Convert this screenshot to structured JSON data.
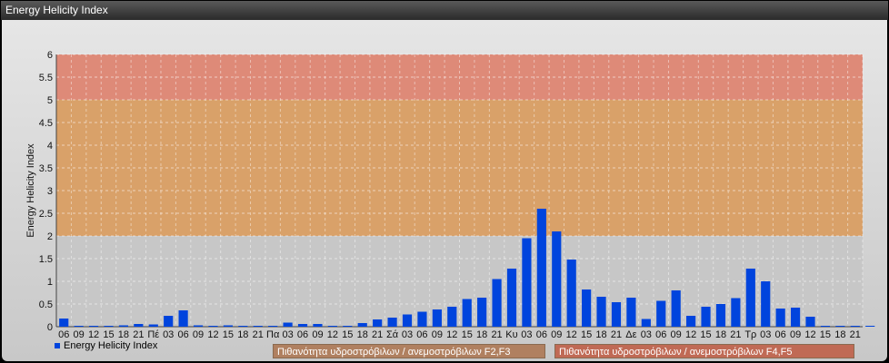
{
  "window": {
    "title": "Energy Helicity Index"
  },
  "chart_data": {
    "type": "bar",
    "title": "",
    "ylabel": "Energy Helicity Index",
    "ylim": [
      0,
      6
    ],
    "yticks": [
      "0",
      "0.5",
      "1",
      "1.5",
      "2",
      "2.5",
      "3",
      "3.5",
      "4",
      "4.5",
      "5",
      "5.5",
      "6"
    ],
    "bands": [
      {
        "from": 2,
        "to": 5,
        "color": "#d9a169"
      },
      {
        "from": 5,
        "to": 6,
        "color": "#de8a78"
      }
    ],
    "categories": [
      "06",
      "09",
      "12",
      "15",
      "18",
      "21",
      "Πέ",
      "03",
      "06",
      "09",
      "12",
      "15",
      "18",
      "21",
      "Πα",
      "03",
      "06",
      "09",
      "12",
      "15",
      "18",
      "21",
      "Σά",
      "03",
      "06",
      "09",
      "12",
      "15",
      "18",
      "21",
      "Κυ",
      "03",
      "06",
      "09",
      "12",
      "15",
      "18",
      "21",
      "Δε",
      "03",
      "06",
      "09",
      "12",
      "15",
      "18",
      "21",
      "Τρ",
      "03",
      "06",
      "09",
      "12",
      "15",
      "18",
      "21"
    ],
    "series": [
      {
        "name": "Energy Helicity Index",
        "color": "#0044dd",
        "values": [
          0.18,
          0.02,
          0.02,
          0.02,
          0.03,
          0.06,
          0.05,
          0.24,
          0.36,
          0.03,
          0.02,
          0.03,
          0.02,
          0.02,
          0.02,
          0.09,
          0.06,
          0.06,
          0.02,
          0.02,
          0.08,
          0.16,
          0.2,
          0.27,
          0.33,
          0.38,
          0.44,
          0.61,
          0.64,
          1.05,
          1.28,
          1.95,
          2.6,
          2.1,
          1.48,
          0.82,
          0.66,
          0.54,
          0.64,
          0.17,
          0.57,
          0.8,
          0.24,
          0.44,
          0.5,
          0.63,
          1.28,
          1.0,
          0.4,
          0.42,
          0.22,
          0.02,
          0.02,
          0.02,
          0.02
        ]
      }
    ],
    "grid": true,
    "legend": "bottom-left"
  },
  "legend": {
    "series_label": "Energy Helicity Index",
    "zone1_label": "Πιθανότητα υδροστρόβιλων / ανεμοστρόβιλων F2,F3",
    "zone2_label": "Πιθανότητα υδροστρόβιλων / ανεμοστρόβιλων F4,F5",
    "zone1_color": "#b08060",
    "zone2_color": "#c06a55"
  }
}
